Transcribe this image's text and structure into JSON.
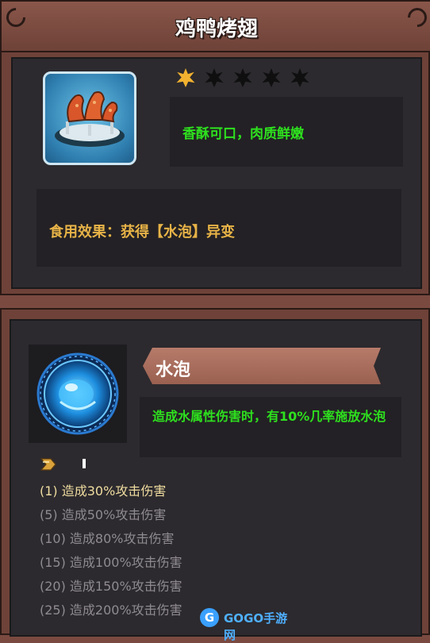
{
  "item": {
    "title": "鸡鸭烤翅",
    "icon": "roast-wings-icon",
    "rarity": {
      "filled": 1,
      "total": 5
    },
    "description": "香酥可口，肉质鲜嫩",
    "effect": "食用效果：获得【水泡】异变"
  },
  "skill": {
    "icon": "water-bubble-icon",
    "name": "水泡",
    "description": "造成水属性伤害时，有10%几率施放水泡",
    "levels": [
      {
        "text": "(1) 造成30%攻击伤害",
        "active": true
      },
      {
        "text": "(5) 造成50%攻击伤害",
        "active": false
      },
      {
        "text": "(10) 造成80%攻击伤害",
        "active": false
      },
      {
        "text": "(15) 造成100%攻击伤害",
        "active": false
      },
      {
        "text": "(20) 造成150%攻击伤害",
        "active": false
      },
      {
        "text": "(25) 造成200%攻击伤害",
        "active": false
      }
    ]
  },
  "watermark": {
    "logo": "G",
    "text": "GOGO手游网"
  },
  "colors": {
    "panel": "#6e4238",
    "inner": "#2c2a2e",
    "green_text": "#2ee01e",
    "gold_text": "#e7b347",
    "star_on": "#f2b230"
  }
}
